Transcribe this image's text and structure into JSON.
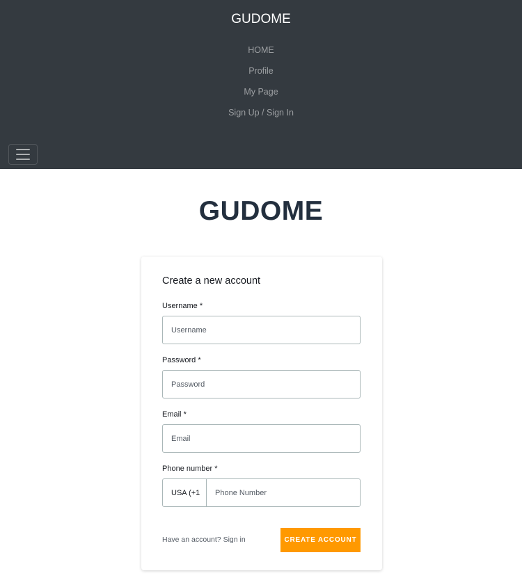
{
  "navbar": {
    "brand": "GUDOME",
    "items": [
      {
        "label": "HOME"
      },
      {
        "label": "Profile"
      },
      {
        "label": "My Page"
      },
      {
        "label": "Sign Up / Sign In"
      }
    ],
    "toggler_icon": "hamburger-menu-icon"
  },
  "hero": {
    "title": "GUDOME"
  },
  "signup_form": {
    "title": "Create a new account",
    "username": {
      "label": "Username",
      "required_mark": "*",
      "placeholder": "Username",
      "value": ""
    },
    "password": {
      "label": "Password",
      "required_mark": "*",
      "placeholder": "Password",
      "value": ""
    },
    "email": {
      "label": "Email",
      "required_mark": "*",
      "placeholder": "Email",
      "value": ""
    },
    "phone": {
      "label": "Phone number",
      "required_mark": "*",
      "dial_code": "USA (+1",
      "placeholder": "Phone Number",
      "value": ""
    },
    "have_account_text": "Have an account?",
    "sign_in_link": "Sign in",
    "submit_label": "Create Account"
  },
  "colors": {
    "navbar_bg": "#343a40",
    "accent": "#ff9900",
    "heading": "#232f3e"
  }
}
